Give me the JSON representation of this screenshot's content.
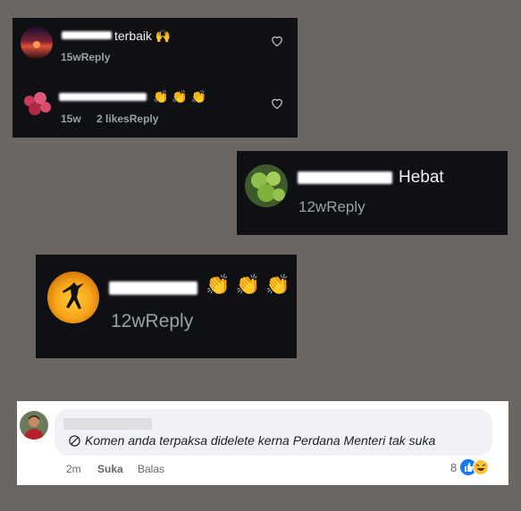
{
  "comment1": {
    "text": "terbaik",
    "emoji": "🙌",
    "time": "15w",
    "reply": "Reply"
  },
  "comment2": {
    "time": "15w",
    "likes": "2 likes",
    "reply": "Reply",
    "emoji": "👏 👏 👏"
  },
  "comment3": {
    "text": "Hebat",
    "time": "12w",
    "reply": "Reply"
  },
  "comment4": {
    "time": "12w",
    "reply": "Reply",
    "emoji": "👏 👏 👏"
  },
  "fb_comment": {
    "deleted_text": "Komen anda terpaksa didelete kerna Perdana Menteri tak suka",
    "time": "2m",
    "like_label": "Suka",
    "reply_label": "Balas",
    "reaction_count": "8"
  },
  "colors": {
    "background": "#6b6662",
    "card": "#0e1014",
    "fb_like_blue": "#1877f2"
  }
}
